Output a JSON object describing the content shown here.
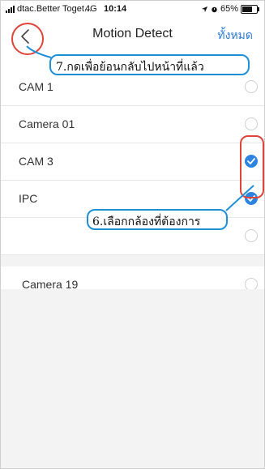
{
  "status_bar": {
    "carrier": "dtac.Better Toget...",
    "network": "4G",
    "time": "10:14",
    "battery_percent": "65%"
  },
  "nav": {
    "title": "Motion Detect",
    "select_all_label": "ทั้งหมด"
  },
  "cameras": [
    {
      "name": "CAM 1",
      "selected": false
    },
    {
      "name": "Camera 01",
      "selected": false
    },
    {
      "name": "CAM 3",
      "selected": true
    },
    {
      "name": "IPC",
      "selected": true
    },
    {
      "name": "",
      "selected": false
    },
    {
      "name": "Camera 19",
      "selected": false
    }
  ],
  "annotations": {
    "back_hint": "7.กดเพื่อย้อนกลับไปหน้าที่แล้ว",
    "select_hint": "6.เลือกกล้องที่ต้องการ"
  },
  "colors": {
    "accent": "#2d84e0",
    "annotation_red": "#e0443a",
    "callout_blue": "#1f90d8"
  }
}
